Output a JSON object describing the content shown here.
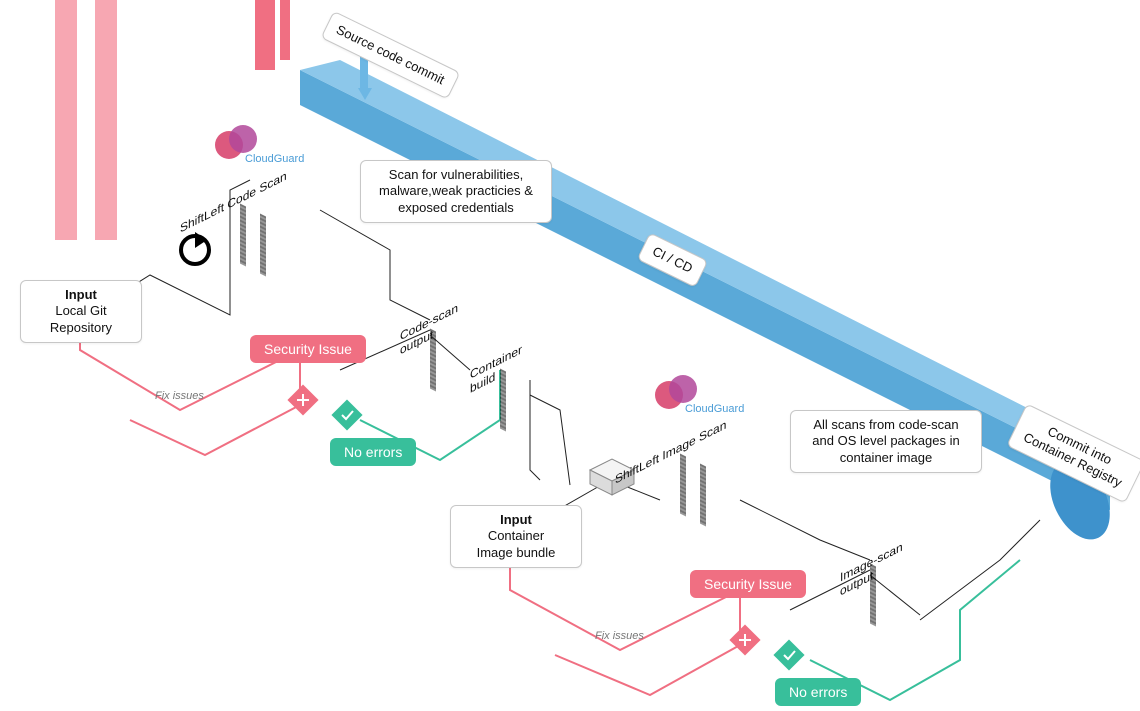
{
  "pipeline": {
    "source_commit": "Source code commit",
    "cicd": "CI / CD",
    "commit_registry": "Commit into\nContainer Registry"
  },
  "input1": {
    "title": "Input",
    "body": "Local Git\nRepository"
  },
  "input2": {
    "title": "Input",
    "body": "Container\nImage bundle"
  },
  "scan1": {
    "tool": "ShiftLeft Code Scan",
    "desc": "Scan for vulnerabilities,\nmalware,weak practicies &\nexposed credentials",
    "logo": "CloudGuard"
  },
  "scan2": {
    "tool": "ShiftLeft Image Scan",
    "desc": "All scans from code-scan\nand OS level packages in\ncontainer image",
    "logo": "CloudGuard"
  },
  "output1": "Code-scan\noutput",
  "output2": "Image-scan\noutput",
  "container_build": "Container\nbuild",
  "issue": "Security Issue",
  "noerr": "No errors",
  "fix": "Fix issues"
}
